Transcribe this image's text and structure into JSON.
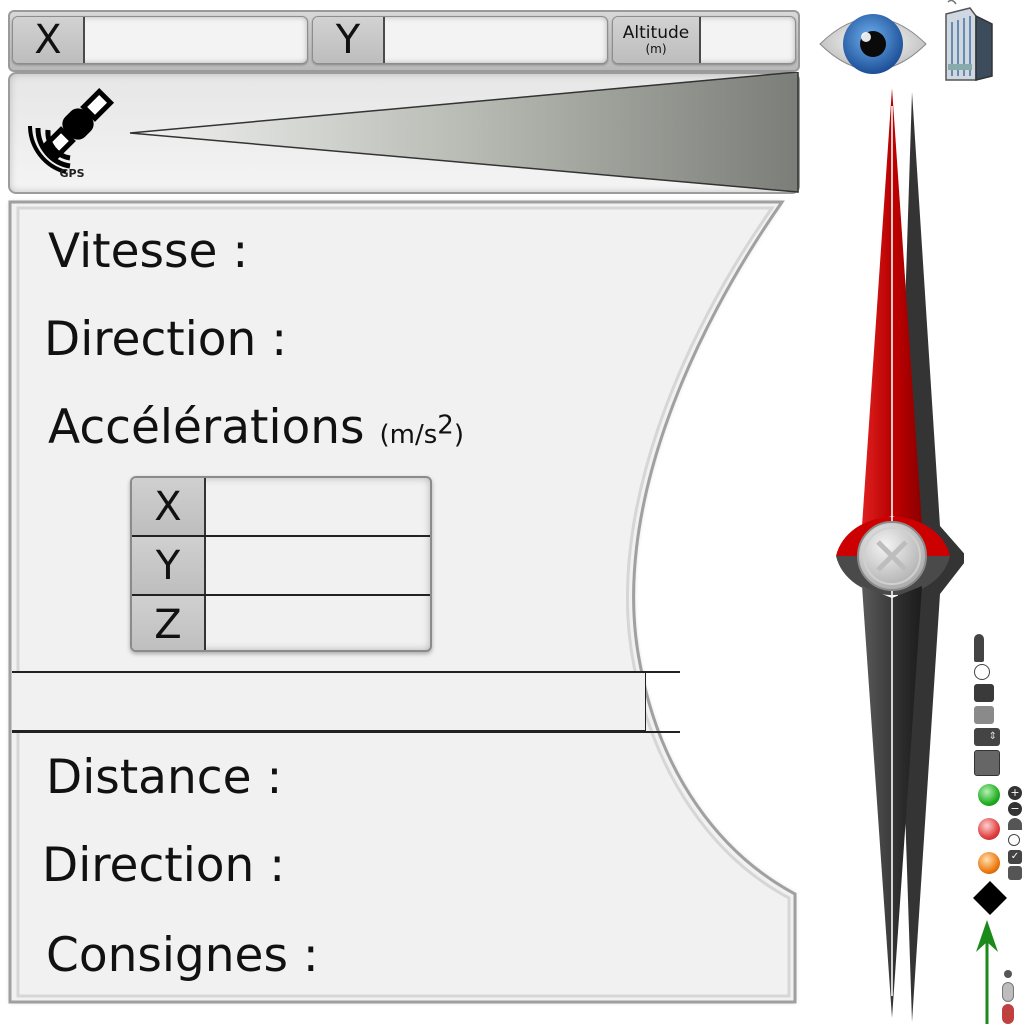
{
  "coords": {
    "x_label": "X",
    "y_label": "Y",
    "altitude_label": "Altitude",
    "altitude_unit": "(m)",
    "x_value": "",
    "y_value": "",
    "altitude_value": ""
  },
  "gps": {
    "label": "GPS"
  },
  "motion": {
    "speed_label": "Vitesse :",
    "direction_label": "Direction :",
    "accel_label": "Accélérations",
    "accel_unit_prefix": "(m/s",
    "accel_unit_exp": "2",
    "accel_unit_suffix": ")",
    "accel_rows": [
      {
        "label": "X",
        "value": ""
      },
      {
        "label": "Y",
        "value": ""
      },
      {
        "label": "Z",
        "value": ""
      }
    ]
  },
  "target": {
    "distance_label": "Distance :",
    "direction_label": "Direction :",
    "instructions_label": "Consignes :"
  },
  "colors": {
    "needle_north": "#cc0000",
    "needle_south": "#3a3a3a",
    "eye_iris": "#2a6fc0",
    "status_green": "#22b022",
    "status_red": "#e04040",
    "status_orange": "#ee7a10",
    "arrow_green": "#1a8a1a"
  },
  "icons": [
    "satellite-icon",
    "eye-icon",
    "building-icon",
    "compass-needle"
  ]
}
